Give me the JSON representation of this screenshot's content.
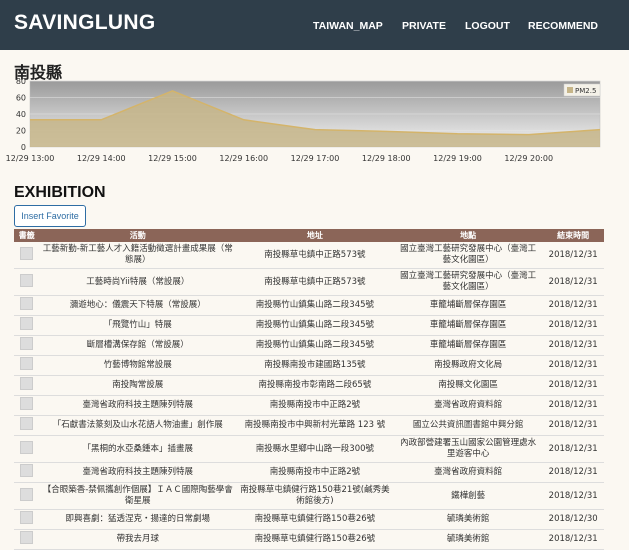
{
  "brand": "SAVINGLUNG",
  "nav": [
    {
      "label": "TAIWAN_MAP"
    },
    {
      "label": "PRIVATE"
    },
    {
      "label": "LOGOUT"
    },
    {
      "label": "RECOMMEND"
    }
  ],
  "page_title": "南投縣",
  "chart_data": {
    "type": "area",
    "x": [
      "12/29 13:00",
      "12/29 14:00",
      "12/29 15:00",
      "12/29 16:00",
      "12/29 17:00",
      "12/29 18:00",
      "12/29 19:00",
      "12/29 20:00",
      "12/29 21:00"
    ],
    "x_tick_labels": [
      "12/29 13:00",
      "12/29 14:00",
      "12/29 15:00",
      "12/29 16:00",
      "12/29 17:00",
      "12/29 18:00",
      "12/29 19:00",
      "12/29 20:00"
    ],
    "series": [
      {
        "name": "PM2.5",
        "values": [
          33,
          33,
          68,
          33,
          21,
          19,
          16,
          15,
          21
        ]
      }
    ],
    "ylim": [
      0,
      80
    ],
    "y_ticks": [
      "0",
      "20",
      "40",
      "60",
      "80"
    ],
    "grid": true,
    "legend_position": "top-right",
    "colors": {
      "fill": "#c6b588",
      "line": "#d4b46a",
      "plot_bg_top": "#9a9a9a",
      "plot_bg_bottom": "#f2f2f2"
    }
  },
  "section_title": "EXHIBITION",
  "insert_button": "Insert Favorite",
  "table": {
    "headers": [
      "書籤",
      "活動",
      "地址",
      "地點",
      "結束時間"
    ],
    "rows": [
      {
        "activity": "工藝新勤-新工藝人才入籍活動徵選計畫成果展（常態展）",
        "address": "南投縣草屯鎮中正路573號",
        "location": "國立臺灣工藝研究發展中心（臺灣工藝文化園區）",
        "end": "2018/12/31",
        "tall": true
      },
      {
        "activity": "工藝時尚Yii特展（常設展）",
        "address": "南投縣草屯鎮中正路573號",
        "location": "國立臺灣工藝研究發展中心（臺灣工藝文化園區）",
        "end": "2018/12/31",
        "tall": true
      },
      {
        "activity": "瀰遊地心：儀震天下特展（常設展）",
        "address": "南投縣竹山鎮集山路二段345號",
        "location": "車籠埔斷層保存園區",
        "end": "2018/12/31",
        "tall": false
      },
      {
        "activity": "「飛覽竹山」特展",
        "address": "南投縣竹山鎮集山路二段345號",
        "location": "車籠埔斷層保存園區",
        "end": "2018/12/31",
        "tall": false
      },
      {
        "activity": "斷層槽溝保存館（常設展）",
        "address": "南投縣竹山鎮集山路二段345號",
        "location": "車籠埔斷層保存園區",
        "end": "2018/12/31",
        "tall": false
      },
      {
        "activity": "竹藝博物館常設展",
        "address": "南投縣南投市建國路135號",
        "location": "南投縣政府文化局",
        "end": "2018/12/31",
        "tall": false
      },
      {
        "activity": "南投陶常設展",
        "address": "南投縣南投市彰南路二段65號",
        "location": "南投縣文化園區",
        "end": "2018/12/31",
        "tall": false
      },
      {
        "activity": "臺灣省政府科技主題陳列特展",
        "address": "南投縣南投市中正路2號",
        "location": "臺灣省政府資料館",
        "end": "2018/12/31",
        "tall": false
      },
      {
        "activity": "「石獻書法篆刻及山水花語人物油畫」創作展",
        "address": "南投縣南投市中興新村光華路 123 號",
        "location": "國立公共資訊圖書館中興分館",
        "end": "2018/12/31",
        "tall": false
      },
      {
        "activity": "「黑桐的水亞桑鍾本」插畫展",
        "address": "南投縣水里鄉中山路一段300號",
        "location": "內政部營建署玉山國家公園管理處水里遊客中心",
        "end": "2018/12/31",
        "tall": true
      },
      {
        "activity": "臺灣省政府科技主題陳列特展",
        "address": "南投縣南投市中正路2號",
        "location": "臺灣省政府資料館",
        "end": "2018/12/31",
        "tall": false
      },
      {
        "activity": "【合眼築香-禁佩攜創作個展】ＩＡＣ國際陶藝學會衛星展",
        "address": "南投縣草屯鎮健行路150巷21號(鹹秀美術館後方)",
        "location": "鐵樺創藝",
        "end": "2018/12/31",
        "tall": true
      },
      {
        "activity": "即興喜劇：猛透涅克・揚達的日常劇場",
        "address": "南投縣草屯鎮健行路150巷26號",
        "location": "毓璘美術館",
        "end": "2018/12/30",
        "tall": false
      },
      {
        "activity": "帶我去月球",
        "address": "南投縣草屯鎮健行路150巷26號",
        "location": "毓璘美術館",
        "end": "2018/12/31",
        "tall": false
      }
    ]
  }
}
